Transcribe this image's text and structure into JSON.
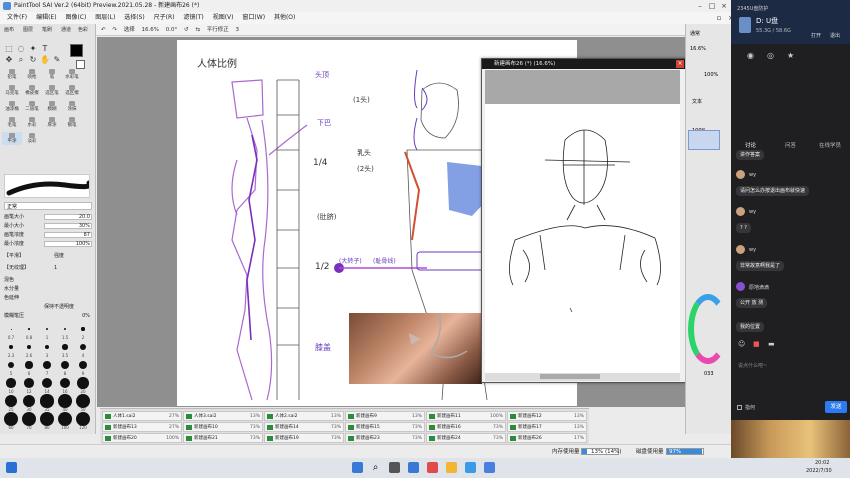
{
  "app": {
    "title": "PaintTool SAI Ver.2 (64bit) Preview.2021.05.28 - 新建画布26 (*)",
    "menu": [
      "文件(F)",
      "编辑(E)",
      "图像(C)",
      "图层(L)",
      "选择(S)",
      "尺子(R)",
      "滤镜(T)",
      "视图(V)",
      "窗口(W)",
      "其他(O)"
    ],
    "toolbar": [
      "选择",
      "16.6%",
      "0.0°",
      "平行修正",
      "3"
    ],
    "tabs": [
      "画布",
      "图层",
      "笔刷",
      "通道",
      "色彩"
    ],
    "brushes": [
      "铅笔",
      "喷枪",
      "笔",
      "水彩笔",
      "马克笔",
      "橡皮擦",
      "选区笔",
      "选区擦",
      "油漆桶",
      "二值笔",
      "模糊",
      "涂抹",
      "毛笔",
      "水彩",
      "厚涂",
      "钢笔",
      "平涂",
      "淡彩"
    ],
    "mode": "正常",
    "props": [
      {
        "label": "画笔大小",
        "value": "20.0"
      },
      {
        "label": "最小大小",
        "value": "30%"
      },
      {
        "label": "画笔浓度",
        "value": "87"
      },
      {
        "label": "最小浓度",
        "value": "100%"
      },
      {
        "label": "【平滑】",
        "value": "强度"
      },
      {
        "label": "【无纹理】",
        "value": "1"
      },
      {
        "label": "混色",
        "value": ""
      },
      {
        "label": "水分量",
        "value": ""
      },
      {
        "label": "色延伸",
        "value": ""
      },
      {
        "label": "保持不透明度",
        "value": ""
      },
      {
        "label": "模糊笔压",
        "value": "0%"
      }
    ],
    "brush_sizes": [
      "0.7",
      "0.8",
      "1",
      "1.5",
      "2",
      "2.3",
      "2.6",
      "3",
      "3.5",
      "4",
      "5",
      "6",
      "7",
      "8",
      "9",
      "10",
      "12",
      "14",
      "16",
      "20",
      "25",
      "30",
      "35",
      "40",
      "50",
      "60",
      "70",
      "80",
      "100",
      "120"
    ]
  },
  "canvas": {
    "annotations": [
      "人体比例",
      "头顶",
      "下巴",
      "(1头)",
      "乳头",
      "(2头)",
      "1/4",
      "(肚脐)",
      "1/2",
      "(大转子)",
      "(耻骨线)",
      "膝盖"
    ]
  },
  "subwindow": {
    "title": "新建画布26 (*) (16.6%)"
  },
  "right_panel": {
    "labels": [
      "通常",
      "16.6%",
      "100%",
      "文本",
      "100%",
      "033"
    ]
  },
  "file_tabs": [
    {
      "name": "人体1.sai2",
      "pct": "27%"
    },
    {
      "name": "人体3.sai2",
      "pct": "13%"
    },
    {
      "name": "人体2.sai2",
      "pct": "13%"
    },
    {
      "name": "新建画布9",
      "pct": "13%"
    },
    {
      "name": "新建画布11",
      "pct": "100%"
    },
    {
      "name": "新建画布12",
      "pct": "13%"
    },
    {
      "name": "新建画布13",
      "pct": "27%"
    },
    {
      "name": "新建画布10",
      "pct": "73%"
    },
    {
      "name": "新建画布14",
      "pct": "73%"
    },
    {
      "name": "新建画布15",
      "pct": "73%"
    },
    {
      "name": "新建画布16",
      "pct": "73%"
    },
    {
      "name": "新建画布17",
      "pct": "13%"
    },
    {
      "name": "新建画布20",
      "pct": "100%"
    },
    {
      "name": "新建画布21",
      "pct": "73%"
    },
    {
      "name": "新建画布19",
      "pct": "73%"
    },
    {
      "name": "新建画布23",
      "pct": "73%"
    },
    {
      "name": "新建画布24",
      "pct": "73%"
    },
    {
      "name": "新建画布26",
      "pct": "17%"
    }
  ],
  "status": {
    "memory_label": "内存使用量",
    "memory_value": "13% (14%)",
    "disk_label": "磁盘使用量",
    "disk_value": "97%"
  },
  "chat": {
    "disk": {
      "name": "D: U盘",
      "size": "55.3G / 58.6G",
      "open": "打开",
      "eject": "退出",
      "brand": "2345U盘防护"
    },
    "tabs": [
      "讨论",
      "问答",
      "在线学员"
    ],
    "messages": [
      {
        "user": "",
        "text": "讲作答案"
      },
      {
        "user": "wy",
        "text": "请问怎么办按退出画布就快速"
      },
      {
        "user": "wy",
        "text": "? ?"
      },
      {
        "user": "wy",
        "text": "非常故意啊我是了"
      },
      {
        "user": "原地滴滴",
        "text": "公开 放 测"
      },
      {
        "user": "",
        "text": "我的位置"
      }
    ],
    "input_placeholder": "说点什么吧~",
    "checkbox": "指何",
    "send": "发送"
  },
  "taskbar": {
    "time": "20:02",
    "date": "2022/7/30"
  }
}
